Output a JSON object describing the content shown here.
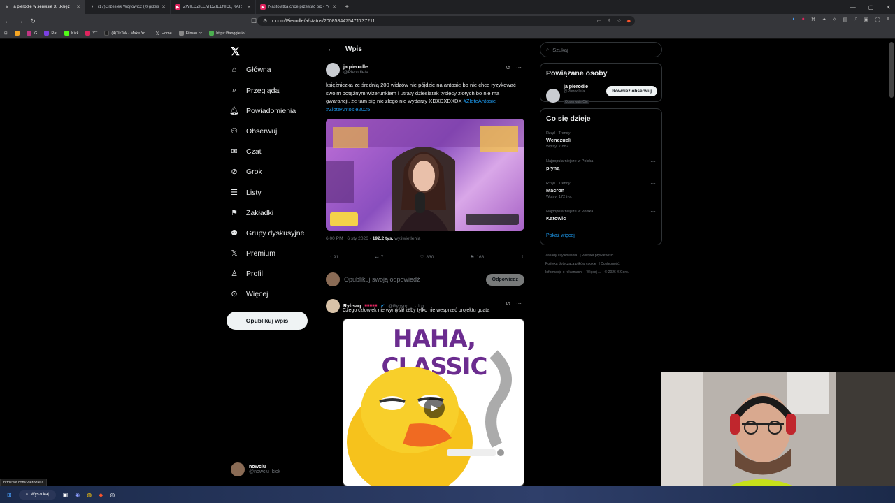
{
  "browser": {
    "tabs": [
      {
        "title": "ja pierodle w serwisie X: „księż",
        "icon": "x-icon",
        "active": true
      },
      {
        "title": "(17)Grzesiek Wójtowicz (@grzesiek_",
        "icon": "tiktok-icon",
        "active": false
      },
      {
        "title": "ZWIEDZIŁEM DZIELNICĘ KARTELI",
        "icon": "youtube-icon",
        "active": false
      },
      {
        "title": "Nastolatka chce przestać pić - YouTu",
        "icon": "youtube-icon",
        "active": false
      }
    ],
    "url": "x.com/Pierodle/a/status/2008584475471737211",
    "bookmarks": [
      "IG",
      "Rat",
      "Kick",
      "YT",
      "(4)TikTok - Make Yo...",
      "Home",
      "Filman.cc",
      "https://tanggle.io/"
    ]
  },
  "nav": {
    "items": [
      {
        "label": "Główna",
        "icon": "home-icon"
      },
      {
        "label": "Przeglądaj",
        "icon": "search-icon"
      },
      {
        "label": "Powiadomienia",
        "icon": "bell-icon"
      },
      {
        "label": "Obserwuj",
        "icon": "add-person-icon"
      },
      {
        "label": "Czat",
        "icon": "mail-icon"
      },
      {
        "label": "Grok",
        "icon": "grok-icon"
      },
      {
        "label": "Listy",
        "icon": "list-icon"
      },
      {
        "label": "Zakładki",
        "icon": "bookmark-icon"
      },
      {
        "label": "Grupy dyskusyjne",
        "icon": "groups-icon"
      },
      {
        "label": "Premium",
        "icon": "x-icon"
      },
      {
        "label": "Profil",
        "icon": "person-icon"
      },
      {
        "label": "Więcej",
        "icon": "more-circle-icon"
      }
    ],
    "post_button": "Opublikuj wpis",
    "account": {
      "name": "nowclu",
      "handle": "@nowclu_kick"
    }
  },
  "main": {
    "header": "Wpis",
    "tweet": {
      "name": "ja pierodle",
      "handle": "@Pierodle/a",
      "text": "księżniczka ze średnią 200 widzów nie pójdzie na antosie bo nie chce ryzykować swoim potężnym wizerunkiem i utraty dziesiątek tysięcy złotych bo nie ma gwarancji, że tam się nic zlego nie wydarzy XDXDXDXDX",
      "hashtags": [
        "#ZloteAntosie",
        "#ZloteAntosie2025"
      ],
      "timestamp": "6:00 PM · 6 sty 2026 · ",
      "views": "192,2 tys.",
      "views_label": " wyświetlenia",
      "stats": {
        "replies": "91",
        "reposts": "7",
        "likes": "830",
        "bookmarks": "168"
      }
    },
    "reply_box": {
      "placeholder": "Opublikuj swoją odpowiedź",
      "button": "Odpowiedz"
    },
    "reply": {
      "name": "Rybsaq",
      "handle": "@Rybson__ · 1 g.",
      "text": "Czego człowiek nie wymyślił żeby tylko nie wesprzeć projektu goata",
      "media_caption": "HAHA, CLASSIC"
    }
  },
  "right": {
    "search_placeholder": "Szukaj",
    "related": {
      "title": "Powiązane osoby",
      "name": "ja pierodle",
      "handle": "@Pierodle/a",
      "badge": "Obserwuje Cię",
      "button": "Również obserwuj"
    },
    "trends": {
      "title": "Co się dzieje",
      "items": [
        {
          "meta": "Rząd · Trendy",
          "title": "Wenezueli",
          "count": "Wpisy: 7 882"
        },
        {
          "meta": "Najpopularniejsze w Polska",
          "title": "płyną",
          "count": ""
        },
        {
          "meta": "Rząd · Trendy",
          "title": "Macron",
          "count": "Wpisy: 172 tys."
        },
        {
          "meta": "Najpopularniejsze w Polska",
          "title": "Katowic",
          "count": ""
        }
      ],
      "show_more": "Pokaż więcej"
    },
    "footer": [
      "Zasady użytkowania",
      "Polityka prywatności",
      "Polityka dotycząca plików cookie",
      "Dostępność",
      "Informacje o reklamach",
      "Więcej ...",
      "© 2026 X Corp."
    ]
  },
  "status_url": "https://x.com/Pierodle/a",
  "taskbar": {
    "search": "Wyszukaj"
  },
  "colors": {
    "accent": "#1d9bf0",
    "background": "#000000"
  }
}
